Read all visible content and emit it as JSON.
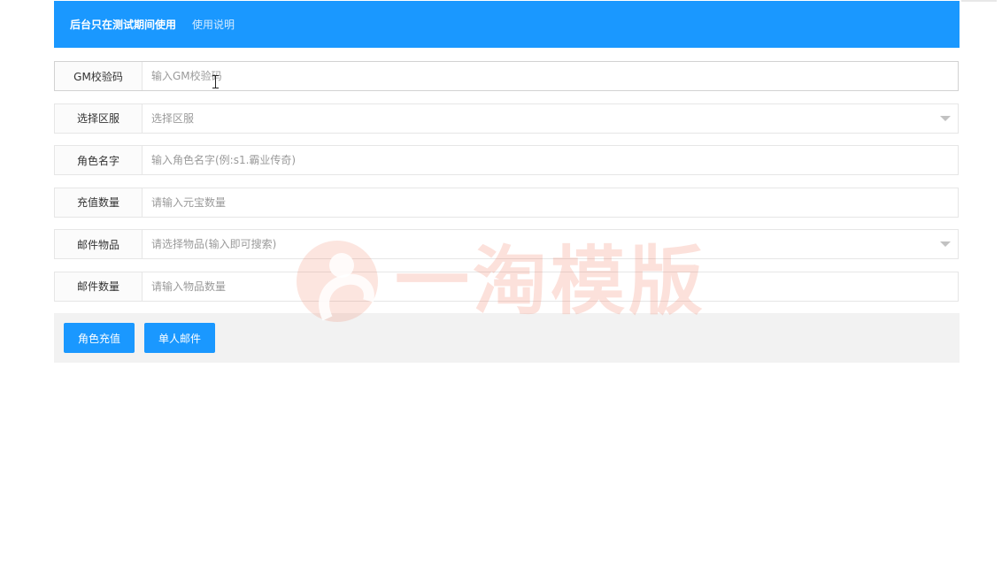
{
  "header": {
    "title": "后台只在测试期间使用",
    "link": "使用说明"
  },
  "form": {
    "gm_code": {
      "label": "GM校验码",
      "placeholder": "输入GM校验码",
      "value": ""
    },
    "server": {
      "label": "选择区服",
      "placeholder": "选择区服",
      "value": ""
    },
    "role_name": {
      "label": "角色名字",
      "placeholder": "输入角色名字(例:s1.霸业传奇)",
      "value": ""
    },
    "recharge_amount": {
      "label": "充值数量",
      "placeholder": "请输入元宝数量",
      "value": ""
    },
    "mail_item": {
      "label": "邮件物品",
      "placeholder": "请选择物品(输入即可搜索)",
      "value": ""
    },
    "mail_count": {
      "label": "邮件数量",
      "placeholder": "请输入物品数量",
      "value": ""
    }
  },
  "buttons": {
    "recharge": "角色充值",
    "single_mail": "单人邮件"
  },
  "watermark": {
    "text": "一淘模版"
  },
  "colors": {
    "primary": "#1a98ff",
    "button_bar_bg": "#f2f2f2",
    "label_bg": "#fbfbfb",
    "border": "#e6e6e6"
  }
}
